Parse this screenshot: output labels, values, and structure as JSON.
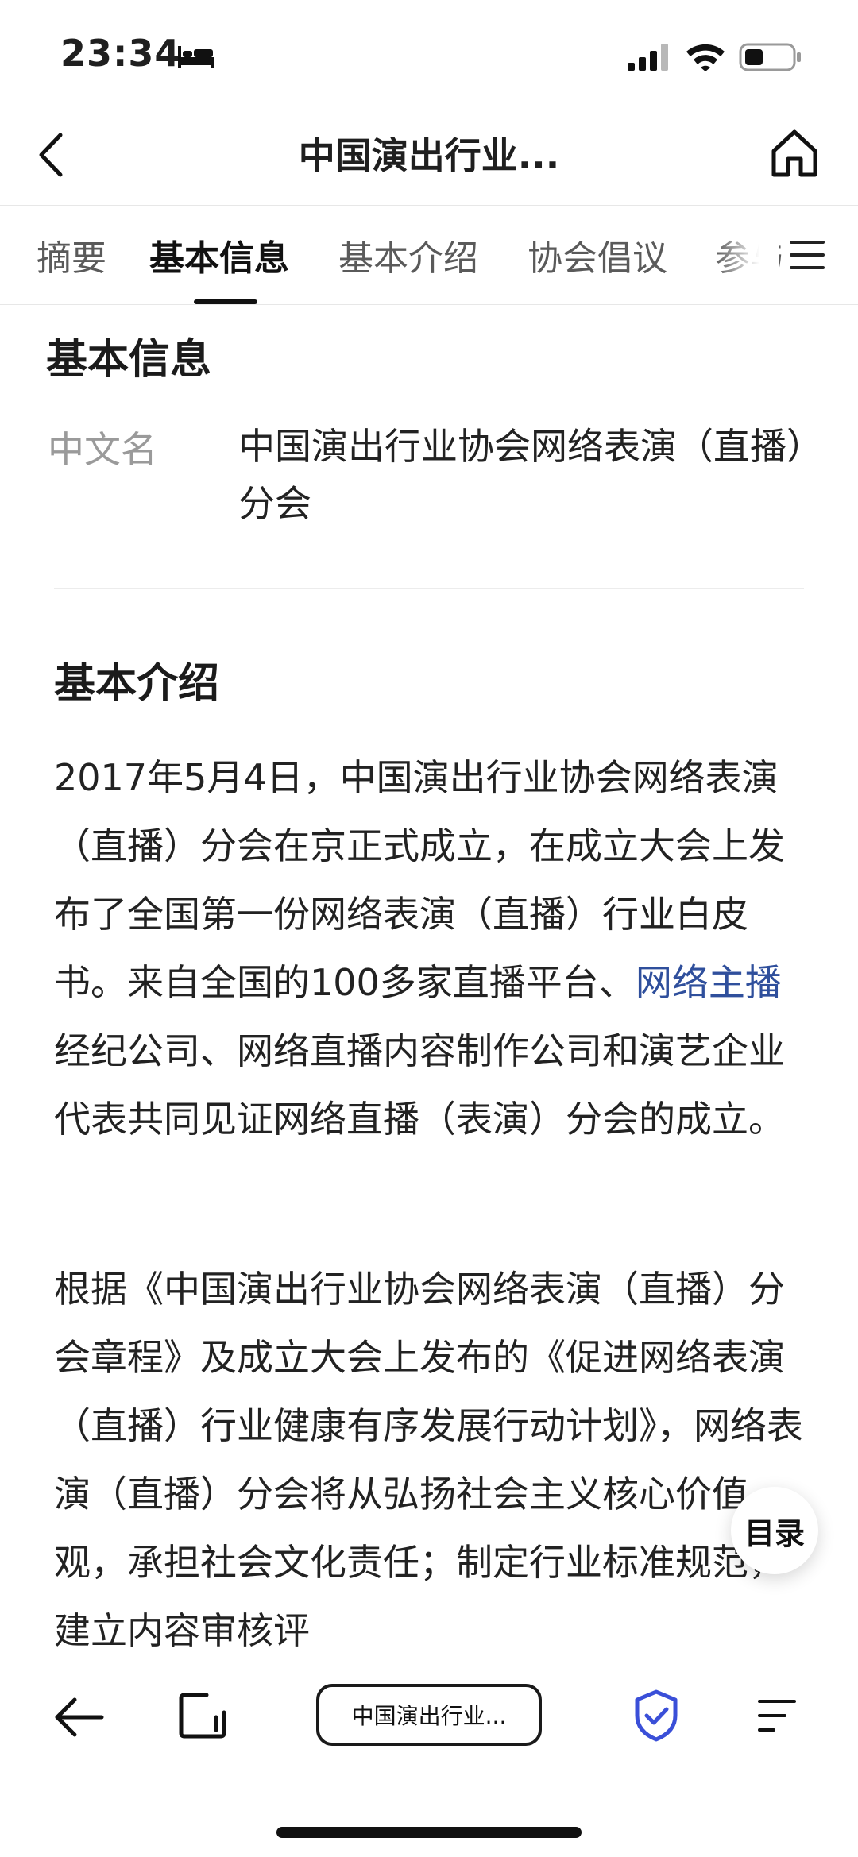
{
  "status": {
    "time": "23:34"
  },
  "nav": {
    "title": "中国演出行业..."
  },
  "tabs": [
    {
      "label": "摘要",
      "active": false
    },
    {
      "label": "基本信息",
      "active": true
    },
    {
      "label": "基本介绍",
      "active": false
    },
    {
      "label": "协会倡议",
      "active": false
    },
    {
      "label": "参与",
      "active": false
    }
  ],
  "basic_info": {
    "heading": "基本信息",
    "rows": [
      {
        "label": "中文名",
        "value": "中国演出行业协会网络表演（直播）分会"
      }
    ]
  },
  "intro": {
    "heading": "基本介绍",
    "para1_before": "2017年5月4日，中国演出行业协会网络表演（直播）分会在京正式成立，在成立大会上发布了全国第一份网络表演（直播）行业白皮书。来自全国的100多家直播平台、",
    "para1_link": "网络主播",
    "para1_after": "经纪公司、网络直播内容制作公司和演艺企业代表共同见证网络直播（表演）分会的成立。",
    "para2": "根据《中国演出行业协会网络表演（直播）分会章程》及成立大会上发布的《促进网络表演（直播）行业健康有序发展行动计划》，网络表演（直播）分会将从弘扬社会主义核心价值观，承担社会文化责任；制定行业标准规范，建立内容审核评"
  },
  "toc_button": "目录",
  "toolbar": {
    "tab_title": "中国演出行业..."
  },
  "colors": {
    "link": "#2f4f9c",
    "shield": "#3a4fd8",
    "text": "#222222"
  }
}
